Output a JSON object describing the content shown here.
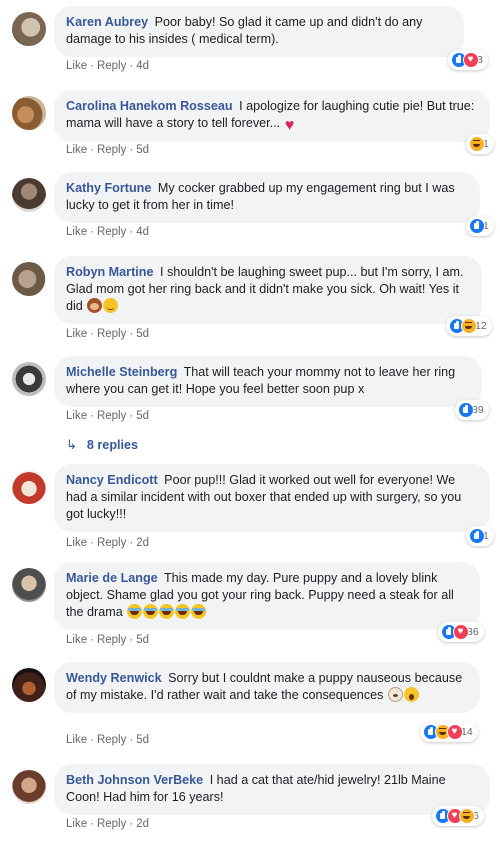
{
  "comments": [
    {
      "author": "Karen Aubrey",
      "text": "Poor baby! So glad it came up and didn't do any damage to his insides ( medical term).",
      "like_label": "Like",
      "reply_label": "Reply",
      "time": "4d",
      "reactions": [
        "like",
        "love"
      ],
      "reaction_count": "3",
      "avatar": "avatar-photo"
    },
    {
      "author": "Carolina Hanekom Rosseau",
      "text": "I apologize for laughing cutie pie! But true: mama will have a story to tell forever...",
      "inline_emojis": [
        "red-heart"
      ],
      "like_label": "Like",
      "reply_label": "Reply",
      "time": "5d",
      "reactions": [
        "haha"
      ],
      "reaction_count": "1",
      "avatar": "avatar-photo"
    },
    {
      "author": "Kathy Fortune",
      "text": "My cocker grabbed up my engagement ring but I was lucky to get it from her in time!",
      "like_label": "Like",
      "reply_label": "Reply",
      "time": "4d",
      "reactions": [
        "like"
      ],
      "reaction_count": "1",
      "avatar": "avatar-photo"
    },
    {
      "author": "Robyn Martine",
      "text": "I shouldn't be laughing sweet pup... but I'm sorry, I am. Glad mom got her ring back and it didn't make you sick. Oh wait! Yes it did",
      "inline_emojis": [
        "see-no-evil-monkey",
        "smiling-blush"
      ],
      "like_label": "Like",
      "reply_label": "Reply",
      "time": "5d",
      "reactions": [
        "like",
        "haha"
      ],
      "reaction_count": "12",
      "avatar": "avatar-photo"
    },
    {
      "author": "Michelle Steinberg",
      "text": "That will teach your mommy not to leave her ring where you can get it! Hope you feel better soon pup x",
      "like_label": "Like",
      "reply_label": "Reply",
      "time": "5d",
      "reactions": [
        "like"
      ],
      "reaction_count": "39",
      "avatar": "avatar-photo"
    },
    {
      "author": "Nancy Endicott",
      "text": "Poor pup!!! Glad it worked out well for everyone! We had a similar incident with out boxer that ended up with surgery, so you got lucky!!!",
      "like_label": "Like",
      "reply_label": "Reply",
      "time": "2d",
      "reactions": [
        "like"
      ],
      "reaction_count": "1",
      "avatar": "avatar-photo"
    },
    {
      "author": "Marie de Lange",
      "text": "This made my day. Pure puppy and a lovely blink object. Shame glad you got your ring back. Puppy need a steak for all the drama",
      "inline_emojis": [
        "tears-of-joy",
        "tears-of-joy",
        "tears-of-joy",
        "tears-of-joy",
        "tears-of-joy"
      ],
      "like_label": "Like",
      "reply_label": "Reply",
      "time": "5d",
      "reactions": [
        "like",
        "love"
      ],
      "reaction_count": "36",
      "avatar": "avatar-photo"
    },
    {
      "author": "Wendy Renwick",
      "text": "Sorry but I couldnt make a puppy nauseous because of my mistake. I'd rather wait and take the consequences",
      "inline_emojis": [
        "dog-face",
        "hand-over-mouth"
      ],
      "like_label": "Like",
      "reply_label": "Reply",
      "time": "5d",
      "reactions": [
        "like",
        "haha",
        "love"
      ],
      "reaction_count": "14",
      "avatar": "avatar-photo"
    },
    {
      "author": "Beth Johnson VerBeke",
      "text": "I had a cat that ate/hid jewelry! 21lb Maine Coon! Had him for 16 years!",
      "like_label": "Like",
      "reply_label": "Reply",
      "time": "2d",
      "reactions": [
        "like",
        "love",
        "haha"
      ],
      "reaction_count": "6",
      "avatar": "avatar-photo"
    }
  ],
  "replies_link": {
    "icon": "reply-arrow-icon",
    "label": "8 replies"
  },
  "colors": {
    "author": "#385898",
    "bubble": "#f2f3f5",
    "meta": "#616770",
    "like": "#1877f2",
    "love": "#f33e58",
    "haha": "#f7b125"
  }
}
